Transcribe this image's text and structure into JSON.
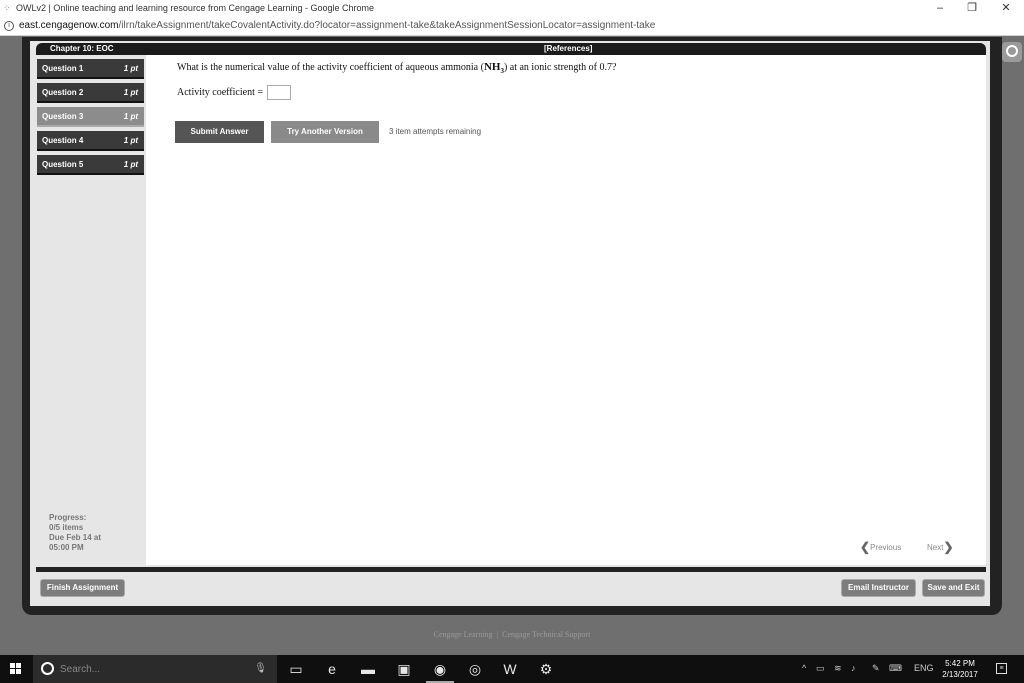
{
  "browser": {
    "window_title": "OWLv2 | Online teaching and learning resource from Cengage Learning - Google Chrome",
    "url_host": "east.cengagenow.com",
    "url_path": "/ilrn/takeAssignment/takeCovalentActivity.do?locator=assignment-take&takeAssignmentSessionLocator=assignment-take",
    "minimize": "–",
    "restore": "❐",
    "close": "✕"
  },
  "header": {
    "chapter": "Chapter 10: EOC",
    "references": "[References]"
  },
  "sidebar": {
    "questions": [
      {
        "label": "Question 1",
        "points": "1 pt"
      },
      {
        "label": "Question 2",
        "points": "1 pt"
      },
      {
        "label": "Question 3",
        "points": "1 pt"
      },
      {
        "label": "Question 4",
        "points": "1 pt"
      },
      {
        "label": "Question 5",
        "points": "1 pt"
      }
    ],
    "active_question": "Question 3",
    "progress_label": "Progress:",
    "progress_value": "0/5 items",
    "due_line1": "Due Feb 14 at",
    "due_line2": "05:00 PM"
  },
  "question": {
    "text_before": "What is the numerical value of the activity coefficient of aqueous ammonia (",
    "chem_main": "NH",
    "chem_sub": "3",
    "text_after": ") at an ionic strength of 0.7?",
    "answer_label": "Activity coefficient =",
    "answer_value": ""
  },
  "actions": {
    "submit": "Submit Answer",
    "try_another": "Try Another Version",
    "attempts": "3 item attempts remaining"
  },
  "navigation": {
    "previous": "Previous",
    "next": "Next"
  },
  "bottom": {
    "finish": "Finish Assignment",
    "email": "Email Instructor",
    "save_exit": "Save and Exit"
  },
  "footer": {
    "brand": "Cengage Learning",
    "separator": "|",
    "support": "Cengage Technical Support"
  },
  "taskbar": {
    "search_placeholder": "Search...",
    "language": "ENG",
    "time": "5:42 PM",
    "date": "2/13/2017"
  }
}
